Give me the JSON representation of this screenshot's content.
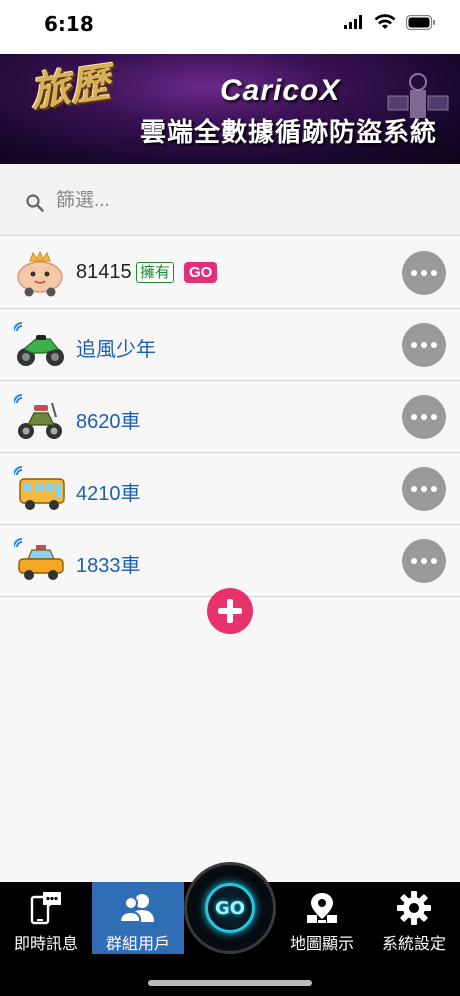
{
  "status_bar": {
    "time": "6:18"
  },
  "banner": {
    "logo_text": "旅歷",
    "brand": "CaricoX",
    "subtitle": "雲端全數據循跡防盜系統"
  },
  "search": {
    "placeholder": "篩選..."
  },
  "vehicles": [
    {
      "name": "81415",
      "owner_badge": "擁有",
      "go_badge": "GO",
      "icon": "cute-car-icon"
    },
    {
      "name": "追風少年",
      "icon": "motorcycle-icon"
    },
    {
      "name": "8620車",
      "icon": "scooter-icon"
    },
    {
      "name": "4210車",
      "icon": "bus-icon"
    },
    {
      "name": "1833車",
      "icon": "taxi-icon"
    }
  ],
  "tabbar": {
    "tabs": [
      {
        "label": "即時訊息",
        "icon": "message-phone-icon"
      },
      {
        "label": "群組用戶",
        "icon": "users-icon",
        "active": true
      },
      {
        "label": "GO",
        "icon": "go-center-icon"
      },
      {
        "label": "地圖顯示",
        "icon": "map-pin-icon"
      },
      {
        "label": "系統設定",
        "icon": "gear-icon"
      }
    ]
  },
  "colors": {
    "accent_blue": "#2f6eb4",
    "add_pink": "#e8336a",
    "name_blue": "#1a5fb4",
    "go_badge": "#e0307a",
    "owner_green": "#1e8a2c"
  }
}
